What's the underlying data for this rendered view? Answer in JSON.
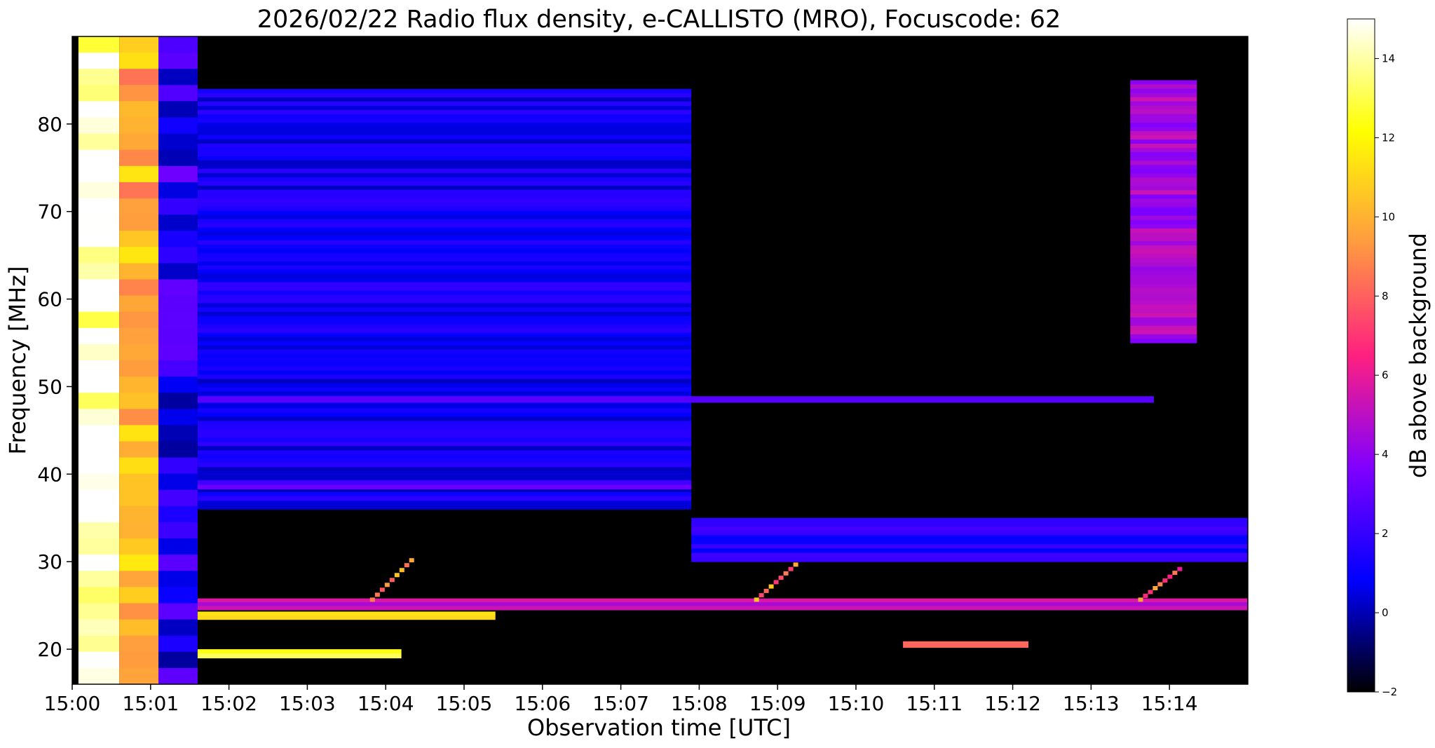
{
  "chart_data": {
    "type": "heatmap",
    "title": "2026/02/22  Radio flux density, e-CALLISTO (MRO), Focuscode: 62",
    "xlabel": "Observation time [UTC]",
    "ylabel": "Frequency [MHz]",
    "x_ticks": [
      "15:00",
      "15:01",
      "15:02",
      "15:03",
      "15:04",
      "15:05",
      "15:06",
      "15:07",
      "15:08",
      "15:09",
      "15:10",
      "15:11",
      "15:12",
      "15:13",
      "15:14"
    ],
    "y_ticks": [
      20,
      30,
      40,
      50,
      60,
      70,
      80
    ],
    "xlim_minutes": [
      0,
      15
    ],
    "ylim": [
      16,
      90
    ],
    "colorbar": {
      "label": "dB above background",
      "ticks": [
        -2,
        0,
        2,
        4,
        6,
        8,
        10,
        12,
        14
      ],
      "range": [
        -2,
        15
      ],
      "colormap": "gnuplot2",
      "colors": [
        "#000000",
        "#0000ff",
        "#8000ff",
        "#ff2080",
        "#ff9a40",
        "#ffff00",
        "#ffffff"
      ]
    },
    "background_dB": -1.2,
    "features": [
      {
        "name": "calibration-hot",
        "t": [
          0.08,
          0.6
        ],
        "f": [
          16,
          90
        ],
        "dB": 14.5
      },
      {
        "name": "calibration-warm",
        "t": [
          0.6,
          1.1
        ],
        "f": [
          16,
          90
        ],
        "dB": 10
      },
      {
        "name": "calibration-cold",
        "t": [
          1.1,
          1.6
        ],
        "f": [
          16,
          90
        ],
        "dB": 1.5
      },
      {
        "name": "broadband-noise-a",
        "t": [
          1.6,
          7.9
        ],
        "f": [
          36,
          84
        ],
        "dB": 1.0
      },
      {
        "name": "broadband-noise-b",
        "t": [
          13.5,
          14.35
        ],
        "f": [
          55,
          85
        ],
        "dB": 4.5
      },
      {
        "name": "band-39MHz",
        "t": [
          1.6,
          7.9
        ],
        "f": [
          38.3,
          39.3
        ],
        "dB": 2.5
      },
      {
        "name": "band-32MHz",
        "t": [
          7.9,
          15
        ],
        "f": [
          30,
          35
        ],
        "dB": 1.5
      },
      {
        "name": "line-48.5MHz",
        "t": [
          1.6,
          13.8
        ],
        "f": [
          48.2,
          48.9
        ],
        "dB": 2.5
      },
      {
        "name": "rfi-24MHz",
        "t": [
          1.6,
          5.4
        ],
        "f": [
          23.4,
          24.3
        ],
        "dB": 11
      },
      {
        "name": "rfi-19.5MHz",
        "t": [
          1.6,
          4.2
        ],
        "f": [
          19.0,
          20.0
        ],
        "dB": 12.5
      },
      {
        "name": "rfi-20.5MHz",
        "t": [
          10.6,
          12.2
        ],
        "f": [
          20.2,
          20.9
        ],
        "dB": 8
      },
      {
        "name": "rfi-25MHz",
        "t": [
          1.6,
          15
        ],
        "f": [
          24.5,
          25.8
        ],
        "dB": 5
      },
      {
        "name": "burst-1",
        "t": [
          3.8,
          4.3
        ],
        "f": [
          25.5,
          30
        ],
        "dB": 9
      },
      {
        "name": "burst-2",
        "t": [
          8.7,
          9.2
        ],
        "f": [
          25.5,
          29.5
        ],
        "dB": 9
      },
      {
        "name": "burst-3",
        "t": [
          13.6,
          14.1
        ],
        "f": [
          25.5,
          29
        ],
        "dB": 8
      }
    ]
  }
}
